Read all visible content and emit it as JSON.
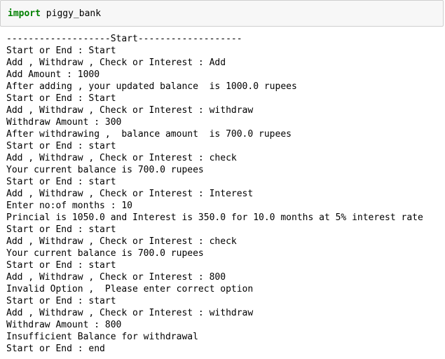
{
  "code_cell": {
    "keyword": "import",
    "module": "piggy_bank"
  },
  "output": {
    "lines": [
      "-------------------Start-------------------",
      "Start or End : Start",
      "Add , Withdraw , Check or Interest : Add",
      "Add Amount : 1000",
      "After adding , your updated balance  is 1000.0 rupees",
      "Start or End : Start",
      "Add , Withdraw , Check or Interest : withdraw",
      "Withdraw Amount : 300",
      "After withdrawing ,  balance amount  is 700.0 rupees",
      "Start or End : start",
      "Add , Withdraw , Check or Interest : check",
      "Your current balance is 700.0 rupees",
      "Start or End : start",
      "Add , Withdraw , Check or Interest : Interest",
      "Enter no:of months : 10",
      "Princial is 1050.0 and Interest is 350.0 for 10.0 months at 5% interest rate",
      "Start or End : start",
      "Add , Withdraw , Check or Interest : check",
      "Your current balance is 700.0 rupees",
      "Start or End : start",
      "Add , Withdraw , Check or Interest : 800",
      "Invalid Option ,  Please enter correct option",
      "Start or End : start",
      "Add , Withdraw , Check or Interest : withdraw",
      "Withdraw Amount : 800",
      "Insufficient Balance for withdrawal",
      "Start or End : end"
    ]
  }
}
